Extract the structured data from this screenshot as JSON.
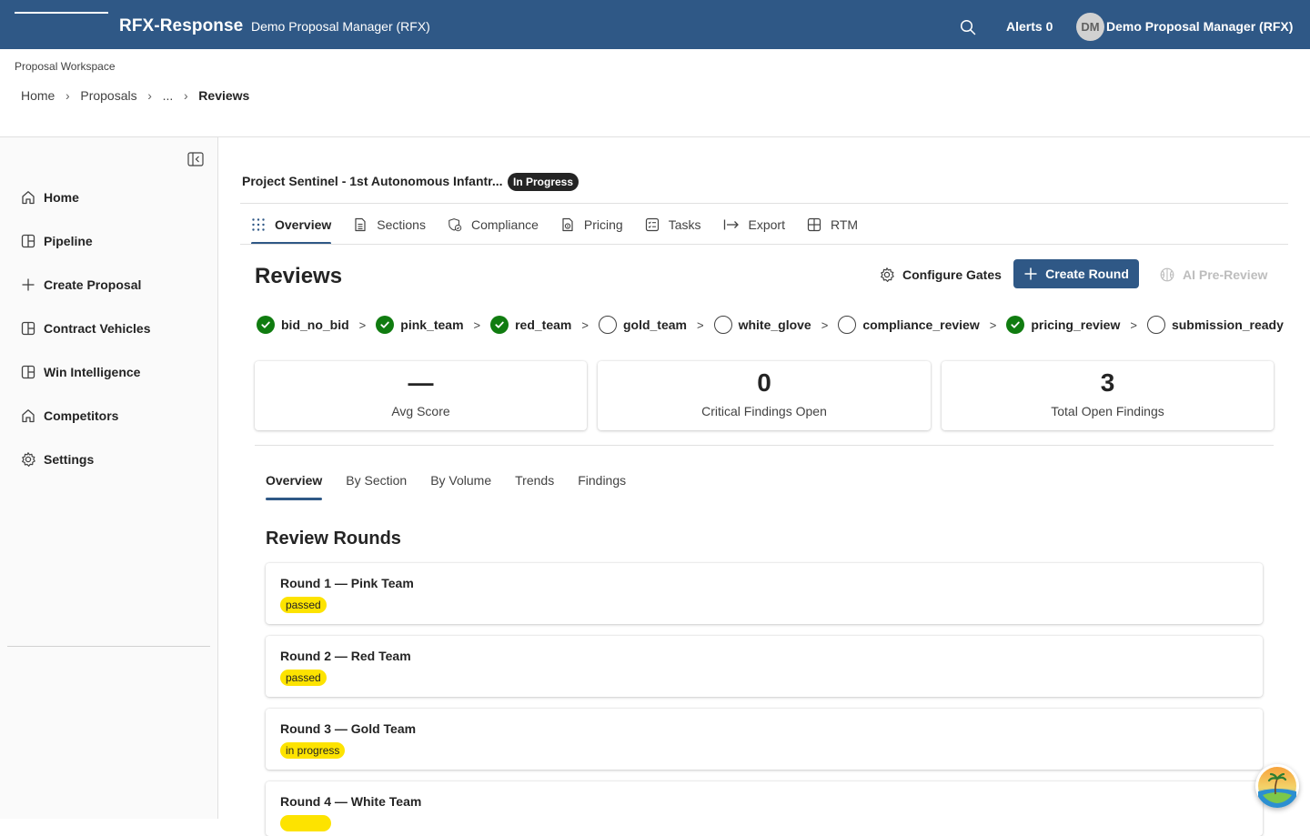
{
  "topbar": {
    "brand": "RFX-Response",
    "subtitle": "Demo Proposal Manager (RFX)",
    "alerts": "Alerts 0",
    "avatar_initials": "DM",
    "username": "Demo Proposal Manager (RFX)",
    "bg_color": "#2f5886"
  },
  "workspace": {
    "label": "Proposal Workspace",
    "breadcrumb": [
      "Home",
      "Proposals",
      "...",
      "Reviews"
    ]
  },
  "sidebar": {
    "items": [
      {
        "label": "Home",
        "icon": "home-icon"
      },
      {
        "label": "Pipeline",
        "icon": "board-icon"
      },
      {
        "label": "Create Proposal",
        "icon": "plus-icon"
      },
      {
        "label": "Contract Vehicles",
        "icon": "board-icon"
      },
      {
        "label": "Win Intelligence",
        "icon": "board-icon"
      },
      {
        "label": "Competitors",
        "icon": "home-icon"
      },
      {
        "label": "Settings",
        "icon": "gear-icon"
      }
    ]
  },
  "project": {
    "title": "Project Sentinel - 1st Autonomous Infantr...",
    "status": "In Progress"
  },
  "tabs": [
    {
      "label": "Overview",
      "icon": "grid-dots-icon"
    },
    {
      "label": "Sections",
      "icon": "document-icon"
    },
    {
      "label": "Compliance",
      "icon": "shield-check-icon"
    },
    {
      "label": "Pricing",
      "icon": "document-money-icon"
    },
    {
      "label": "Tasks",
      "icon": "task-list-icon"
    },
    {
      "label": "Export",
      "icon": "arrow-export-icon"
    },
    {
      "label": "RTM",
      "icon": "table-icon"
    }
  ],
  "reviews": {
    "title": "Reviews",
    "configure_gates": "Configure Gates",
    "create_round": "Create Round",
    "ai_pre_review": "AI Pre-Review"
  },
  "gates": [
    {
      "label": "bid_no_bid",
      "done": true
    },
    {
      "label": "pink_team",
      "done": true
    },
    {
      "label": "red_team",
      "done": true
    },
    {
      "label": "gold_team",
      "done": false
    },
    {
      "label": "white_glove",
      "done": false
    },
    {
      "label": "compliance_review",
      "done": false
    },
    {
      "label": "pricing_review",
      "done": true
    },
    {
      "label": "submission_ready",
      "done": false
    }
  ],
  "gate_separator": ">",
  "stats": [
    {
      "value": "—",
      "label": "Avg Score"
    },
    {
      "value": "0",
      "label": "Critical Findings Open"
    },
    {
      "value": "3",
      "label": "Total Open Findings"
    }
  ],
  "subtabs": [
    "Overview",
    "By Section",
    "By Volume",
    "Trends",
    "Findings"
  ],
  "rounds": {
    "title": "Review Rounds",
    "items": [
      {
        "title": "Round 1 — Pink Team",
        "status": "passed"
      },
      {
        "title": "Round 2 — Red Team",
        "status": "passed"
      },
      {
        "title": "Round 3 — Gold Team",
        "status": "in progress"
      },
      {
        "title": "Round 4 — White Team",
        "status": ""
      }
    ]
  },
  "colors": {
    "accent": "#2f5886",
    "success": "#107c10",
    "badge_yellow": "#fde300"
  }
}
